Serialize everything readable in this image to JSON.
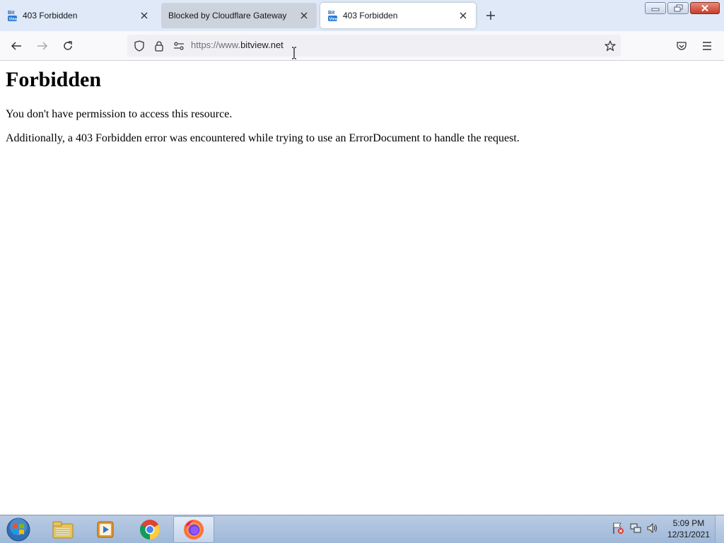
{
  "browser": {
    "tabs": [
      {
        "label": "403 Forbidden",
        "favicon": "bitview-icon",
        "active": false
      },
      {
        "label": "Blocked by Cloudflare Gateway",
        "favicon": "none",
        "active": false
      },
      {
        "label": "403 Forbidden",
        "favicon": "bitview-icon",
        "active": true
      }
    ],
    "address": {
      "scheme": "https://www.",
      "host": "bitview.net"
    }
  },
  "page": {
    "heading": "Forbidden",
    "paragraphs": [
      "You don't have permission to access this resource.",
      "Additionally, a 403 Forbidden error was encountered while trying to use an ErrorDocument to handle the request."
    ]
  },
  "taskbar": {
    "apps": [
      "file-explorer-icon",
      "media-player-icon",
      "chrome-icon",
      "firefox-icon"
    ],
    "clock": {
      "time": "5:09 PM",
      "date": "12/31/2021"
    }
  },
  "colors": {
    "tabstrip": "#dfe9f7",
    "active_tab": "#ffffff",
    "url_field": "#f0f0f4",
    "taskbar": "#a9bfdc"
  }
}
